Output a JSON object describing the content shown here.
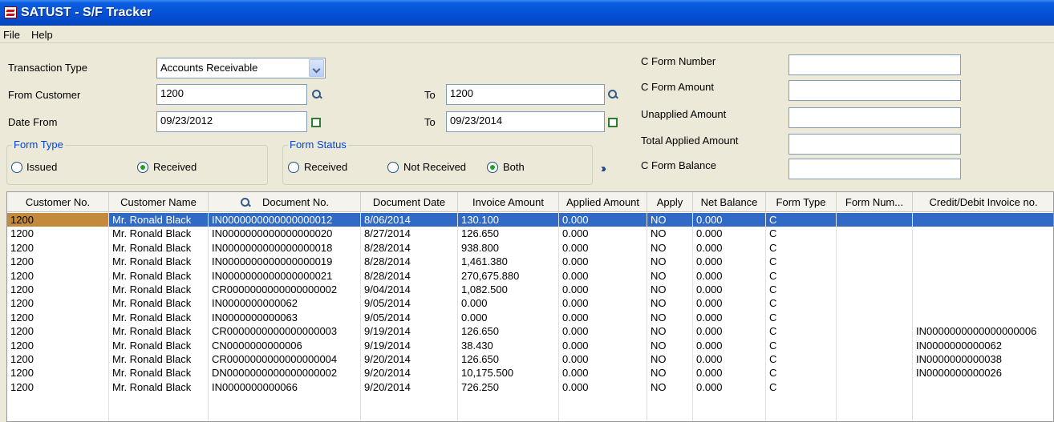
{
  "window": {
    "title": "SATUST - S/F Tracker",
    "icon": "app-logo-icon"
  },
  "menu": [
    "File",
    "Help"
  ],
  "filters": {
    "transaction_type": {
      "label": "Transaction Type",
      "value": "Accounts Receivable"
    },
    "from_customer": {
      "label": "From Customer",
      "value": "1200"
    },
    "to_customer": {
      "label": "To",
      "value": "1200"
    },
    "date_from": {
      "label": "Date From",
      "value": "09/23/2012"
    },
    "date_to": {
      "label": "To",
      "value": "09/23/2014"
    }
  },
  "form_type": {
    "title": "Form Type",
    "options": [
      "Issued",
      "Received"
    ],
    "selected": "Received"
  },
  "form_status": {
    "title": "Form Status",
    "options": [
      "Received",
      "Not Received",
      "Both"
    ],
    "selected": "Both"
  },
  "summary": {
    "c_form_number": {
      "label": "C Form Number",
      "value": ""
    },
    "c_form_amount": {
      "label": "C Form Amount",
      "value": ""
    },
    "unapplied_amount": {
      "label": "Unapplied Amount",
      "value": ""
    },
    "total_applied_amount": {
      "label": "Total Applied Amount",
      "value": ""
    },
    "c_form_balance": {
      "label": "C Form Balance",
      "value": ""
    }
  },
  "grid": {
    "columns": [
      "Customer No.",
      "Customer Name",
      "Document No.",
      "Document Date",
      "Invoice Amount",
      "Applied Amount",
      "Apply",
      "Net Balance",
      "Form Type",
      "Form Num...",
      "Credit/Debit Invoice no."
    ],
    "rows": [
      [
        "1200",
        "Mr. Ronald Black",
        "IN0000000000000000012",
        "8/06/2014",
        "130.100",
        "0.000",
        "NO",
        "0.000",
        "C",
        "",
        ""
      ],
      [
        "1200",
        "Mr. Ronald Black",
        "IN0000000000000000020",
        "8/27/2014",
        "126.650",
        "0.000",
        "NO",
        "0.000",
        "C",
        "",
        ""
      ],
      [
        "1200",
        "Mr. Ronald Black",
        "IN0000000000000000018",
        "8/28/2014",
        "938.800",
        "0.000",
        "NO",
        "0.000",
        "C",
        "",
        ""
      ],
      [
        "1200",
        "Mr. Ronald Black",
        "IN0000000000000000019",
        "8/28/2014",
        "1,461.380",
        "0.000",
        "NO",
        "0.000",
        "C",
        "",
        ""
      ],
      [
        "1200",
        "Mr. Ronald Black",
        "IN0000000000000000021",
        "8/28/2014",
        "270,675.880",
        "0.000",
        "NO",
        "0.000",
        "C",
        "",
        ""
      ],
      [
        "1200",
        "Mr. Ronald Black",
        "CR0000000000000000002",
        "9/04/2014",
        "1,082.500",
        "0.000",
        "NO",
        "0.000",
        "C",
        "",
        ""
      ],
      [
        "1200",
        "Mr. Ronald Black",
        "IN0000000000062",
        "9/05/2014",
        "0.000",
        "0.000",
        "NO",
        "0.000",
        "C",
        "",
        ""
      ],
      [
        "1200",
        "Mr. Ronald Black",
        "IN0000000000063",
        "9/05/2014",
        "0.000",
        "0.000",
        "NO",
        "0.000",
        "C",
        "",
        ""
      ],
      [
        "1200",
        "Mr. Ronald Black",
        "CR0000000000000000003",
        "9/19/2014",
        "126.650",
        "0.000",
        "NO",
        "0.000",
        "C",
        "",
        "IN0000000000000000006"
      ],
      [
        "1200",
        "Mr. Ronald Black",
        "CN0000000000006",
        "9/19/2014",
        "38.430",
        "0.000",
        "NO",
        "0.000",
        "C",
        "",
        "IN0000000000062"
      ],
      [
        "1200",
        "Mr. Ronald Black",
        "CR0000000000000000004",
        "9/20/2014",
        "126.650",
        "0.000",
        "NO",
        "0.000",
        "C",
        "",
        "IN0000000000038"
      ],
      [
        "1200",
        "Mr. Ronald Black",
        "DN0000000000000000002",
        "9/20/2014",
        "10,175.500",
        "0.000",
        "NO",
        "0.000",
        "C",
        "",
        "IN0000000000026"
      ],
      [
        "1200",
        "Mr. Ronald Black",
        "IN0000000000066",
        "9/20/2014",
        "726.250",
        "0.000",
        "NO",
        "0.000",
        "C",
        "",
        ""
      ]
    ],
    "selected_row": 0
  }
}
